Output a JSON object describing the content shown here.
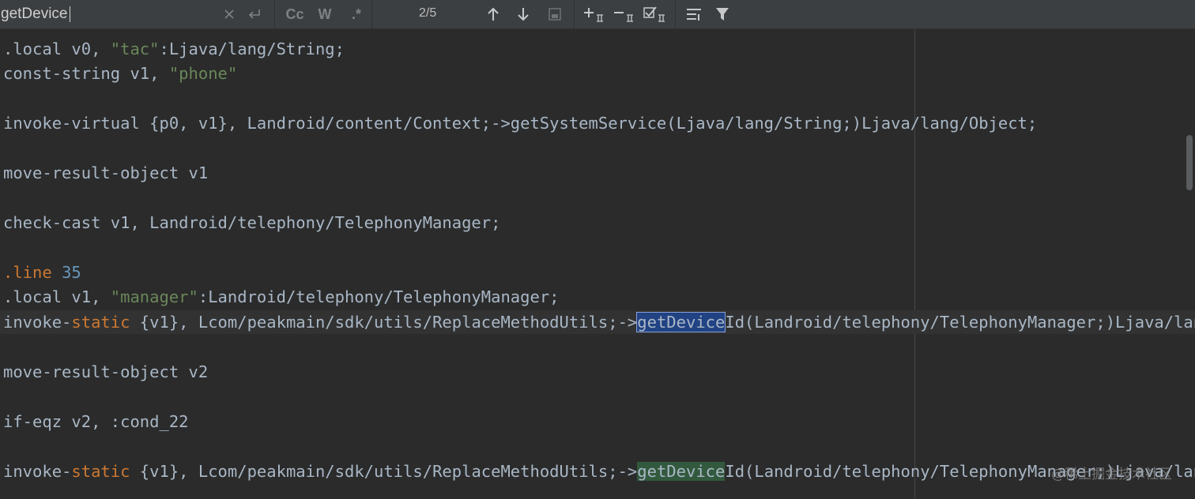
{
  "search": {
    "query": "getDevice",
    "match_counter": "2/5",
    "case_label": "Cc",
    "words_label": "W",
    "regex_label": ".*"
  },
  "code": {
    "lines": [
      {
        "parts": [
          {
            "t": ".local v0, "
          },
          {
            "t": "\"tac\"",
            "c": "str"
          },
          {
            "t": ":Ljava/lang/String;"
          }
        ]
      },
      {
        "parts": [
          {
            "t": "const-string v1, "
          },
          {
            "t": "\"phone\"",
            "c": "str"
          }
        ]
      },
      {
        "parts": [
          {
            "t": "invoke-virtual {p0, v1}, Landroid/content/Context;->getSystemService(Ljava/lang/String;)Ljava/lang/Object;"
          }
        ]
      },
      {
        "parts": [
          {
            "t": "move-result-object v1"
          }
        ]
      },
      {
        "parts": [
          {
            "t": "check-cast v1, Landroid/telephony/TelephonyManager;"
          }
        ]
      },
      {
        "parts": [
          {
            "t": ".line ",
            "c": "kw"
          },
          {
            "t": "35",
            "c": "num"
          }
        ]
      },
      {
        "parts": [
          {
            "t": ".local v1, "
          },
          {
            "t": "\"manager\"",
            "c": "str"
          },
          {
            "t": ":Landroid/telephony/TelephonyManager;"
          }
        ]
      },
      {
        "parts": [
          {
            "t": "invoke-"
          },
          {
            "t": "static",
            "c": "kw"
          },
          {
            "t": " {v1}, Lcom/peakmain/sdk/utils/ReplaceMethodUtils;->"
          },
          {
            "t": "getDevice",
            "c": "hl-current"
          },
          {
            "t": "Id(Landroid/telephony/TelephonyManager;)Ljava/lang/S"
          }
        ]
      },
      {
        "parts": [
          {
            "t": "move-result-object v2"
          }
        ]
      },
      {
        "parts": [
          {
            "t": "if-eqz v2, :cond_22"
          }
        ]
      },
      {
        "parts": [
          {
            "t": "invoke-"
          },
          {
            "t": "static",
            "c": "kw"
          },
          {
            "t": " {v1}, Lcom/peakmain/sdk/utils/ReplaceMethodUtils;->"
          },
          {
            "t": "getDevice",
            "c": "hl-match"
          },
          {
            "t": "Id(Landroid/telephony/TelephonyManager;)Ljava/lang/S"
          }
        ]
      }
    ]
  },
  "watermark": "@稀土掘金技术社区",
  "colors": {
    "background": "#2b2b2b",
    "toolbar": "#3c3f41",
    "string": "#6a8759",
    "keyword": "#cc7832",
    "number": "#6897bb",
    "default_text": "#a9b7c6",
    "current_match": "#214283",
    "other_match": "#32593d"
  }
}
